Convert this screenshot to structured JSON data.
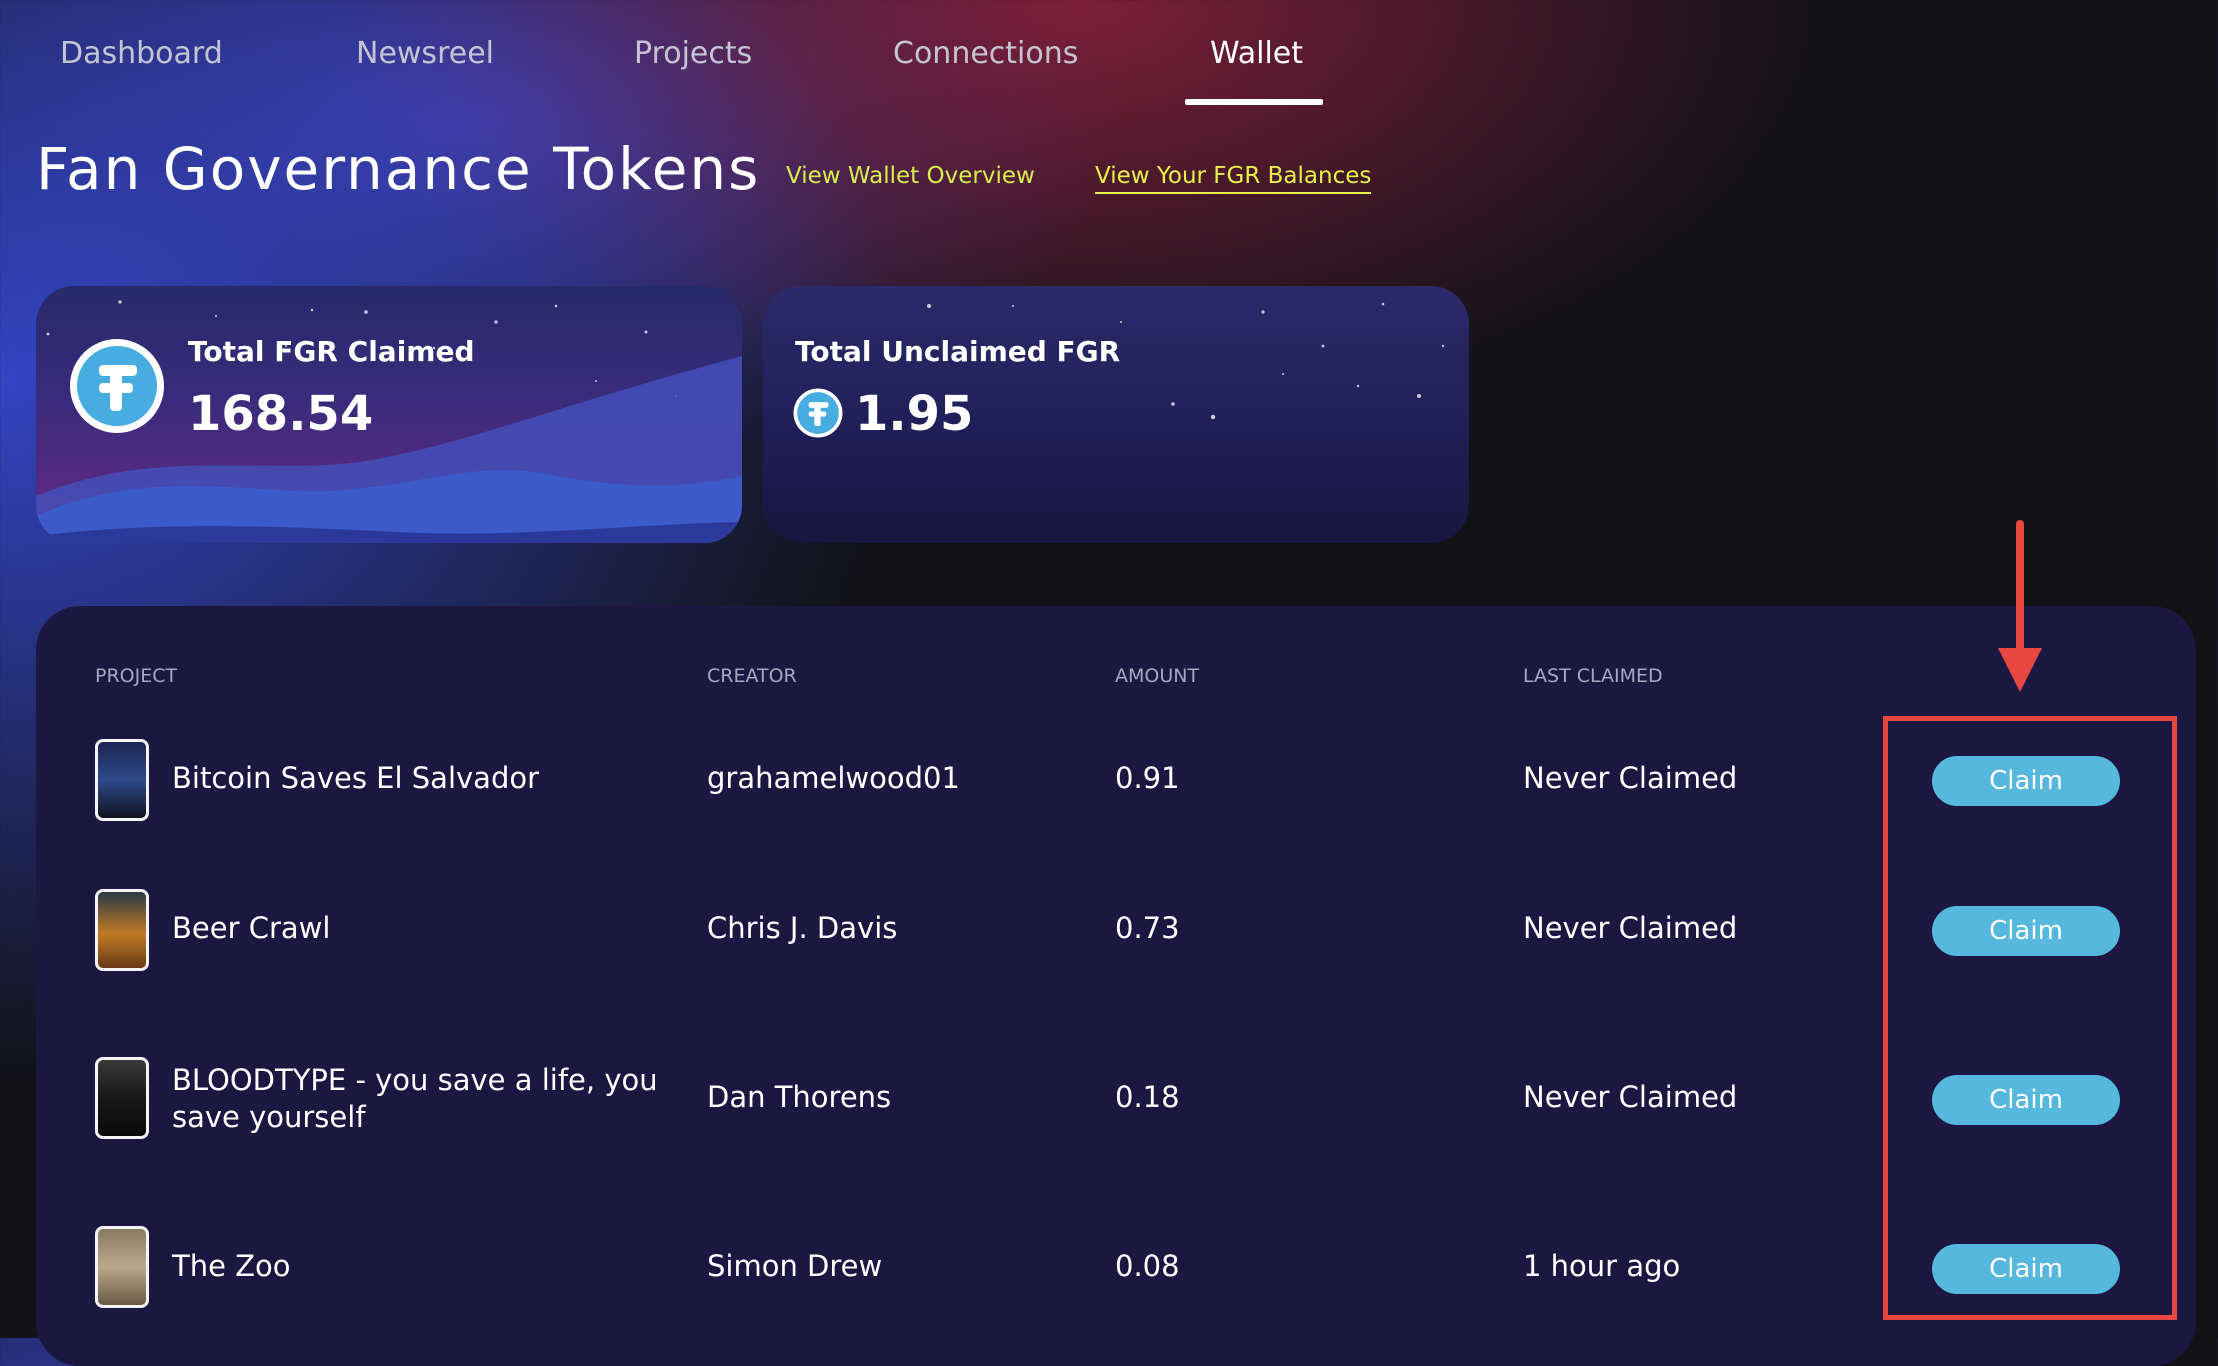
{
  "nav": {
    "tabs": [
      {
        "label": "Dashboard"
      },
      {
        "label": "Newsreel"
      },
      {
        "label": "Projects"
      },
      {
        "label": "Connections"
      },
      {
        "label": "Wallet"
      }
    ],
    "active_tab": "Wallet"
  },
  "header": {
    "title": "Fan Governance Tokens",
    "link_overview": "View Wallet Overview",
    "link_balances": "View Your FGR Balances"
  },
  "cards": {
    "claimed": {
      "label": "Total FGR Claimed",
      "value": "168.54"
    },
    "unclaimed": {
      "label": "Total Unclaimed FGR",
      "value": "1.95"
    }
  },
  "table": {
    "headers": {
      "project": "PROJECT",
      "creator": "CREATOR",
      "amount": "AMOUNT",
      "last_claimed": "LAST CLAIMED"
    },
    "rows": [
      {
        "project": "Bitcoin Saves El Salvador",
        "creator": "grahamelwood01",
        "amount": "0.91",
        "last_claimed": "Never Claimed",
        "action": "Claim"
      },
      {
        "project": "Beer Crawl",
        "creator": "Chris J. Davis",
        "amount": "0.73",
        "last_claimed": "Never Claimed",
        "action": "Claim"
      },
      {
        "project": "BLOODTYPE - you save a life, you save yourself",
        "creator": "Dan Thorens",
        "amount": "0.18",
        "last_claimed": "Never Claimed",
        "action": "Claim"
      },
      {
        "project": "The Zoo",
        "creator": "Simon Drew",
        "amount": "0.08",
        "last_claimed": "1 hour ago",
        "action": "Claim"
      }
    ]
  },
  "colors": {
    "accent_link": "#d6ee4e",
    "claim_button": "#55b8dc",
    "panel": "#1b1740",
    "annotation": "#e8473f"
  },
  "icons": {
    "token": "fgr-token-icon",
    "annotation_arrow": "red-arrow-down"
  }
}
